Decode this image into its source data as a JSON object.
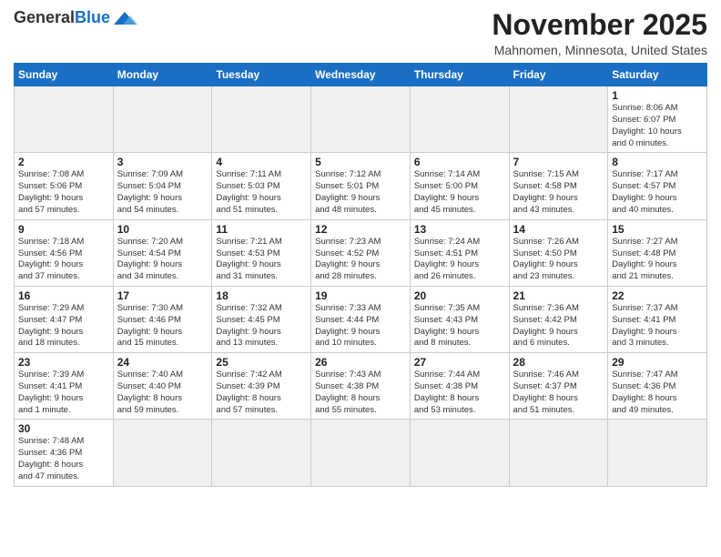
{
  "logo": {
    "general": "General",
    "blue": "Blue"
  },
  "title": "November 2025",
  "subtitle": "Mahnomen, Minnesota, United States",
  "weekdays": [
    "Sunday",
    "Monday",
    "Tuesday",
    "Wednesday",
    "Thursday",
    "Friday",
    "Saturday"
  ],
  "weeks": [
    [
      {
        "day": "",
        "info": ""
      },
      {
        "day": "",
        "info": ""
      },
      {
        "day": "",
        "info": ""
      },
      {
        "day": "",
        "info": ""
      },
      {
        "day": "",
        "info": ""
      },
      {
        "day": "",
        "info": ""
      },
      {
        "day": "1",
        "info": "Sunrise: 8:06 AM\nSunset: 6:07 PM\nDaylight: 10 hours\nand 0 minutes."
      }
    ],
    [
      {
        "day": "2",
        "info": "Sunrise: 7:08 AM\nSunset: 5:06 PM\nDaylight: 9 hours\nand 57 minutes."
      },
      {
        "day": "3",
        "info": "Sunrise: 7:09 AM\nSunset: 5:04 PM\nDaylight: 9 hours\nand 54 minutes."
      },
      {
        "day": "4",
        "info": "Sunrise: 7:11 AM\nSunset: 5:03 PM\nDaylight: 9 hours\nand 51 minutes."
      },
      {
        "day": "5",
        "info": "Sunrise: 7:12 AM\nSunset: 5:01 PM\nDaylight: 9 hours\nand 48 minutes."
      },
      {
        "day": "6",
        "info": "Sunrise: 7:14 AM\nSunset: 5:00 PM\nDaylight: 9 hours\nand 45 minutes."
      },
      {
        "day": "7",
        "info": "Sunrise: 7:15 AM\nSunset: 4:58 PM\nDaylight: 9 hours\nand 43 minutes."
      },
      {
        "day": "8",
        "info": "Sunrise: 7:17 AM\nSunset: 4:57 PM\nDaylight: 9 hours\nand 40 minutes."
      }
    ],
    [
      {
        "day": "9",
        "info": "Sunrise: 7:18 AM\nSunset: 4:56 PM\nDaylight: 9 hours\nand 37 minutes."
      },
      {
        "day": "10",
        "info": "Sunrise: 7:20 AM\nSunset: 4:54 PM\nDaylight: 9 hours\nand 34 minutes."
      },
      {
        "day": "11",
        "info": "Sunrise: 7:21 AM\nSunset: 4:53 PM\nDaylight: 9 hours\nand 31 minutes."
      },
      {
        "day": "12",
        "info": "Sunrise: 7:23 AM\nSunset: 4:52 PM\nDaylight: 9 hours\nand 28 minutes."
      },
      {
        "day": "13",
        "info": "Sunrise: 7:24 AM\nSunset: 4:51 PM\nDaylight: 9 hours\nand 26 minutes."
      },
      {
        "day": "14",
        "info": "Sunrise: 7:26 AM\nSunset: 4:50 PM\nDaylight: 9 hours\nand 23 minutes."
      },
      {
        "day": "15",
        "info": "Sunrise: 7:27 AM\nSunset: 4:48 PM\nDaylight: 9 hours\nand 21 minutes."
      }
    ],
    [
      {
        "day": "16",
        "info": "Sunrise: 7:29 AM\nSunset: 4:47 PM\nDaylight: 9 hours\nand 18 minutes."
      },
      {
        "day": "17",
        "info": "Sunrise: 7:30 AM\nSunset: 4:46 PM\nDaylight: 9 hours\nand 15 minutes."
      },
      {
        "day": "18",
        "info": "Sunrise: 7:32 AM\nSunset: 4:45 PM\nDaylight: 9 hours\nand 13 minutes."
      },
      {
        "day": "19",
        "info": "Sunrise: 7:33 AM\nSunset: 4:44 PM\nDaylight: 9 hours\nand 10 minutes."
      },
      {
        "day": "20",
        "info": "Sunrise: 7:35 AM\nSunset: 4:43 PM\nDaylight: 9 hours\nand 8 minutes."
      },
      {
        "day": "21",
        "info": "Sunrise: 7:36 AM\nSunset: 4:42 PM\nDaylight: 9 hours\nand 6 minutes."
      },
      {
        "day": "22",
        "info": "Sunrise: 7:37 AM\nSunset: 4:41 PM\nDaylight: 9 hours\nand 3 minutes."
      }
    ],
    [
      {
        "day": "23",
        "info": "Sunrise: 7:39 AM\nSunset: 4:41 PM\nDaylight: 9 hours\nand 1 minute."
      },
      {
        "day": "24",
        "info": "Sunrise: 7:40 AM\nSunset: 4:40 PM\nDaylight: 8 hours\nand 59 minutes."
      },
      {
        "day": "25",
        "info": "Sunrise: 7:42 AM\nSunset: 4:39 PM\nDaylight: 8 hours\nand 57 minutes."
      },
      {
        "day": "26",
        "info": "Sunrise: 7:43 AM\nSunset: 4:38 PM\nDaylight: 8 hours\nand 55 minutes."
      },
      {
        "day": "27",
        "info": "Sunrise: 7:44 AM\nSunset: 4:38 PM\nDaylight: 8 hours\nand 53 minutes."
      },
      {
        "day": "28",
        "info": "Sunrise: 7:46 AM\nSunset: 4:37 PM\nDaylight: 8 hours\nand 51 minutes."
      },
      {
        "day": "29",
        "info": "Sunrise: 7:47 AM\nSunset: 4:36 PM\nDaylight: 8 hours\nand 49 minutes."
      }
    ],
    [
      {
        "day": "30",
        "info": "Sunrise: 7:48 AM\nSunset: 4:36 PM\nDaylight: 8 hours\nand 47 minutes."
      },
      {
        "day": "",
        "info": ""
      },
      {
        "day": "",
        "info": ""
      },
      {
        "day": "",
        "info": ""
      },
      {
        "day": "",
        "info": ""
      },
      {
        "day": "",
        "info": ""
      },
      {
        "day": "",
        "info": ""
      }
    ]
  ]
}
